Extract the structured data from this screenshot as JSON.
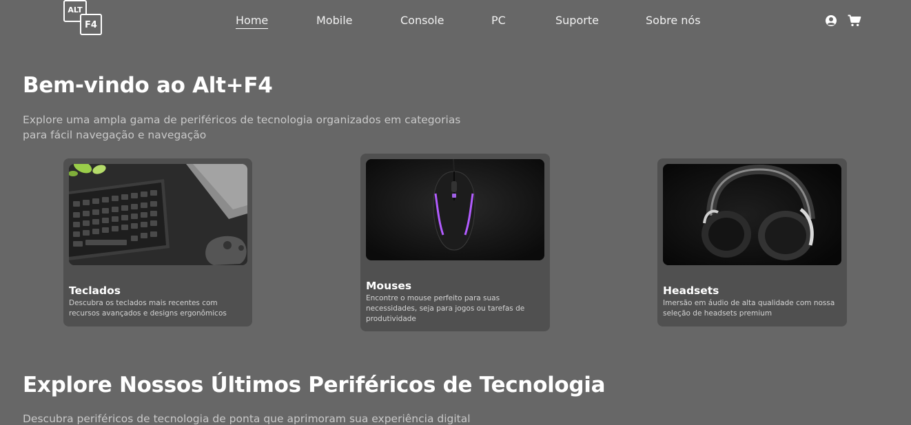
{
  "brand": {
    "logo_key1": "ALT",
    "logo_key2": "F4"
  },
  "nav": {
    "items": [
      {
        "label": "Home",
        "active": true
      },
      {
        "label": "Mobile",
        "active": false
      },
      {
        "label": "Console",
        "active": false
      },
      {
        "label": "PC",
        "active": false
      },
      {
        "label": "Suporte",
        "active": false
      },
      {
        "label": "Sobre nós",
        "active": false
      }
    ],
    "icons": [
      "user-circle-icon",
      "shopping-cart-icon"
    ]
  },
  "hero": {
    "title": "Bem-vindo ao Alt+F4",
    "text": "Explore uma ampla gama de periféricos de tecnologia organizados em categorias para fácil navegação e navegação"
  },
  "categories": [
    {
      "title": "Teclados",
      "description": "Descubra os teclados mais recentes com recursos avançados e designs ergonômicos",
      "image": "keyboard-photo"
    },
    {
      "title": "Mouses",
      "description": "Encontre o mouse perfeito para suas necessidades, seja para jogos ou tarefas de produtividade",
      "image": "mouse-photo"
    },
    {
      "title": "Headsets",
      "description": "Imersão em áudio de alta qualidade com nossa seleção de headsets premium",
      "image": "headset-photo"
    }
  ],
  "latest": {
    "title": "Explore Nossos Últimos Periféricos de Tecnologia",
    "text": "Descubra periféricos de tecnologia de ponta que aprimoram sua experiência digital"
  },
  "colors": {
    "background": "#676767",
    "card": "#505050",
    "muted_text": "#c9c9c9"
  }
}
